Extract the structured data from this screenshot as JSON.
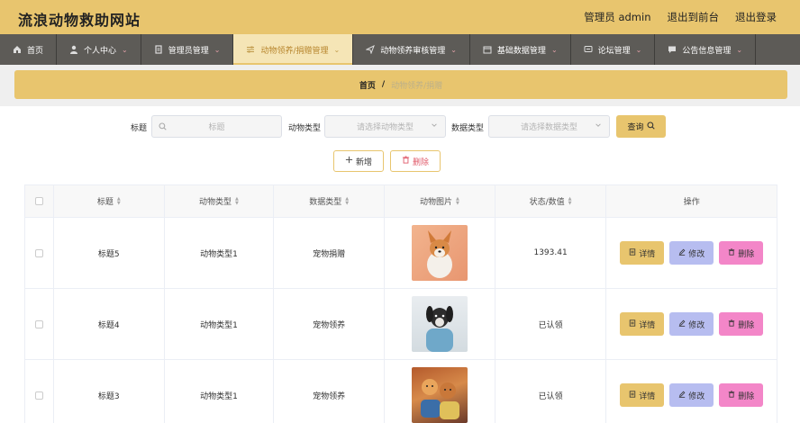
{
  "header": {
    "site_title": "流浪动物救助网站",
    "admin_label": "管理员 admin",
    "front_link": "退出到前台",
    "logout": "退出登录"
  },
  "nav": {
    "items": [
      {
        "label": "首页",
        "icon": "home-icon"
      },
      {
        "label": "个人中心",
        "icon": "user-icon"
      },
      {
        "label": "管理员管理",
        "icon": "doc-icon"
      },
      {
        "label": "动物领养/捐赠管理",
        "icon": "sliders-icon"
      },
      {
        "label": "动物领养审核管理",
        "icon": "send-icon"
      },
      {
        "label": "基础数据管理",
        "icon": "calendar-icon"
      },
      {
        "label": "论坛管理",
        "icon": "chat-icon"
      },
      {
        "label": "公告信息管理",
        "icon": "message-icon"
      }
    ]
  },
  "breadcrumb": {
    "home": "首页",
    "sep": "/",
    "current": "动物领养/捐赠"
  },
  "filter": {
    "title_label": "标题",
    "title_placeholder": "标题",
    "animal_type_label": "动物类型",
    "animal_type_placeholder": "请选择动物类型",
    "data_type_label": "数据类型",
    "data_type_placeholder": "请选择数据类型",
    "query_button": "查询"
  },
  "actions": {
    "add": "新增",
    "delete": "删除"
  },
  "table": {
    "headers": {
      "title": "标题",
      "animal_type": "动物类型",
      "data_type": "数据类型",
      "image": "动物图片",
      "status": "状态/数值",
      "ops": "操作"
    },
    "rows": [
      {
        "title": "标题5",
        "animal_type": "动物类型1",
        "data_type": "宠物捐赠",
        "status": "1393.41"
      },
      {
        "title": "标题4",
        "animal_type": "动物类型1",
        "data_type": "宠物领养",
        "status": "已认领"
      },
      {
        "title": "标题3",
        "animal_type": "动物类型1",
        "data_type": "宠物领养",
        "status": "已认领"
      }
    ],
    "op_labels": {
      "detail": "详情",
      "edit": "修改",
      "delete": "删除"
    }
  },
  "colors": {
    "accent": "#e8c56e",
    "nav_bg": "#5d5b57",
    "edit_btn": "#b7bdf0",
    "delete_btn": "#f386c8"
  }
}
